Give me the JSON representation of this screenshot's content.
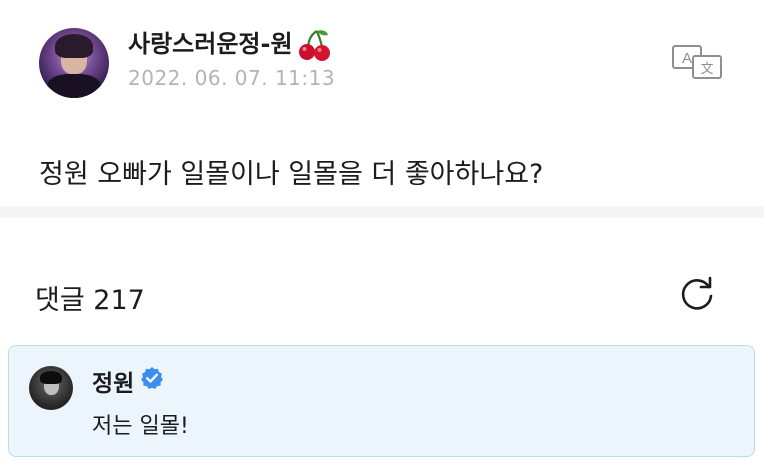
{
  "post": {
    "author_name": "사랑스러운정-원",
    "author_emoji_icon": "cherry-icon",
    "timestamp": "2022. 06. 07. 11:13",
    "translate_icon": "translate-icon",
    "question": "정원 오빠가 일몰이나 일몰을 더 좋아하나요?"
  },
  "comments": {
    "label": "댓글 217",
    "refresh_icon": "refresh-icon",
    "items": [
      {
        "author": "정원",
        "verified": true,
        "text": "저는 일몰!"
      }
    ]
  },
  "colors": {
    "verified_blue": "#3b8df0",
    "card_bg": "#ecf5fb",
    "card_border": "#b9dbef",
    "timestamp_gray": "#b3b3b8",
    "divider": "#f3f4f6"
  }
}
